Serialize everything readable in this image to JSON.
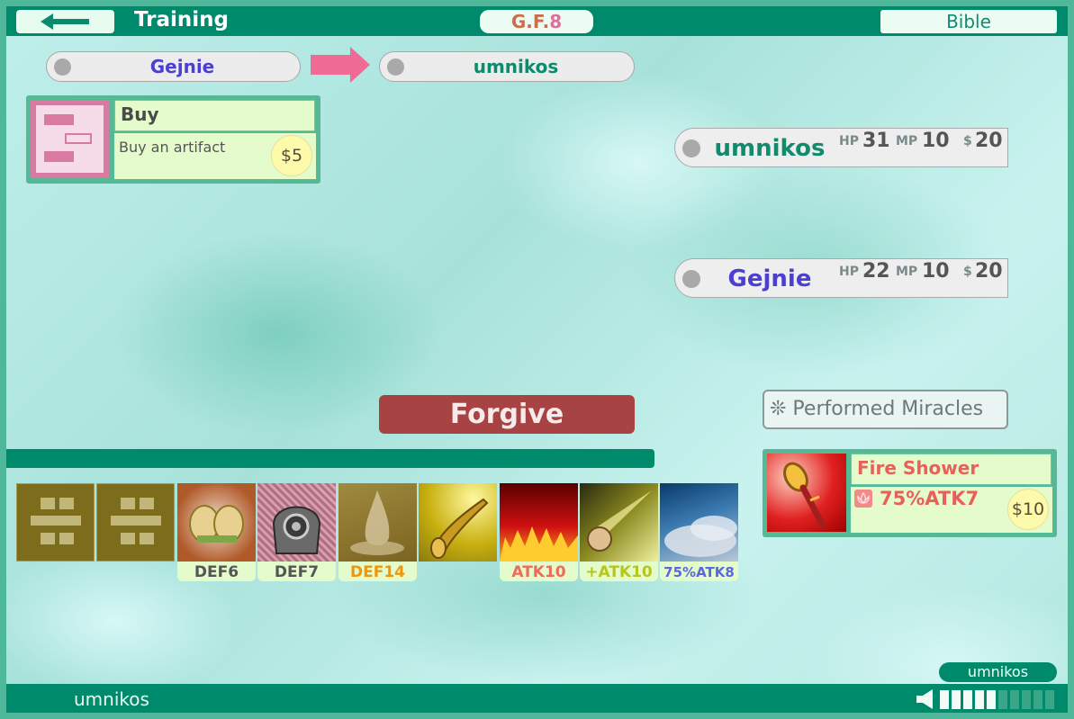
{
  "header": {
    "title": "Training",
    "gf_prefix": "G.F.",
    "gf_number": "8",
    "bible_label": "Bible"
  },
  "transfer": {
    "from_player": "Gejnie",
    "to_player": "umnikos"
  },
  "action_card": {
    "title": "Buy",
    "description": "Buy an artifact",
    "price": "$5"
  },
  "players": [
    {
      "name": "umnikos",
      "hp_label": "HP",
      "hp": "31",
      "mp_label": "MP",
      "mp": "10",
      "money_label": "$",
      "money": "20",
      "color": "#118b6e"
    },
    {
      "name": "Gejnie",
      "hp_label": "HP",
      "hp": "22",
      "mp_label": "MP",
      "mp": "10",
      "money_label": "$",
      "money": "20",
      "color": "#4a3fd0"
    }
  ],
  "forgive_label": "Forgive",
  "miracles_label": "❊ Performed Miracles",
  "miracle_card": {
    "title": "Fire Shower",
    "effect": "75%ATK7",
    "price": "$10"
  },
  "hand": [
    {
      "icon": "empty-slot-icon",
      "label": ""
    },
    {
      "icon": "empty-slot-icon",
      "label": ""
    },
    {
      "icon": "golden-gloves-icon",
      "label": "DEF6"
    },
    {
      "icon": "iron-helmet-icon",
      "label": "DEF7"
    },
    {
      "icon": "water-splash-icon",
      "label": "DEF14"
    },
    {
      "icon": "golden-horn-icon",
      "label": ""
    },
    {
      "icon": "flames-icon",
      "label": "ATK10"
    },
    {
      "icon": "meteor-icon",
      "label": "+ATK10"
    },
    {
      "icon": "storm-cloud-icon",
      "label": "75%ATK8"
    }
  ],
  "colors": {
    "brand": "#008a6c",
    "def_normal": "#555555",
    "def_orange": "#f0960c",
    "atk_red": "#ee6a5a",
    "atk_yellow": "#b6c61a",
    "atk_blue": "#5b67de"
  },
  "footer": {
    "current_user": "umnikos",
    "user_tag": "umnikos",
    "volume_level": 0.5
  }
}
